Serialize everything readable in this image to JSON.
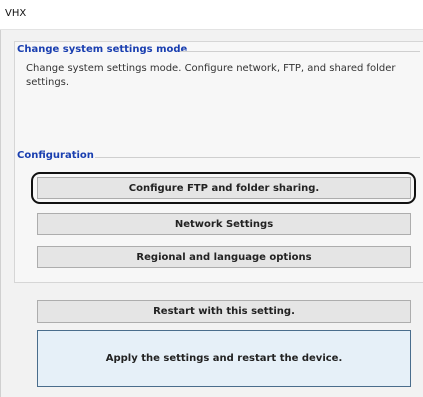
{
  "window": {
    "title": "VHX"
  },
  "mode_section": {
    "header": "Change system settings mode",
    "description": "Change system settings mode. Configure network, FTP, and shared folder settings."
  },
  "config_section": {
    "header": "Configuration",
    "buttons": [
      {
        "label": "Configure FTP and folder sharing.",
        "focused": true
      },
      {
        "label": "Network Settings"
      },
      {
        "label": "Regional and language options"
      }
    ]
  },
  "actions": {
    "restart_label": "Restart with this setting.",
    "apply_restart_label": "Apply the settings and restart the device."
  }
}
